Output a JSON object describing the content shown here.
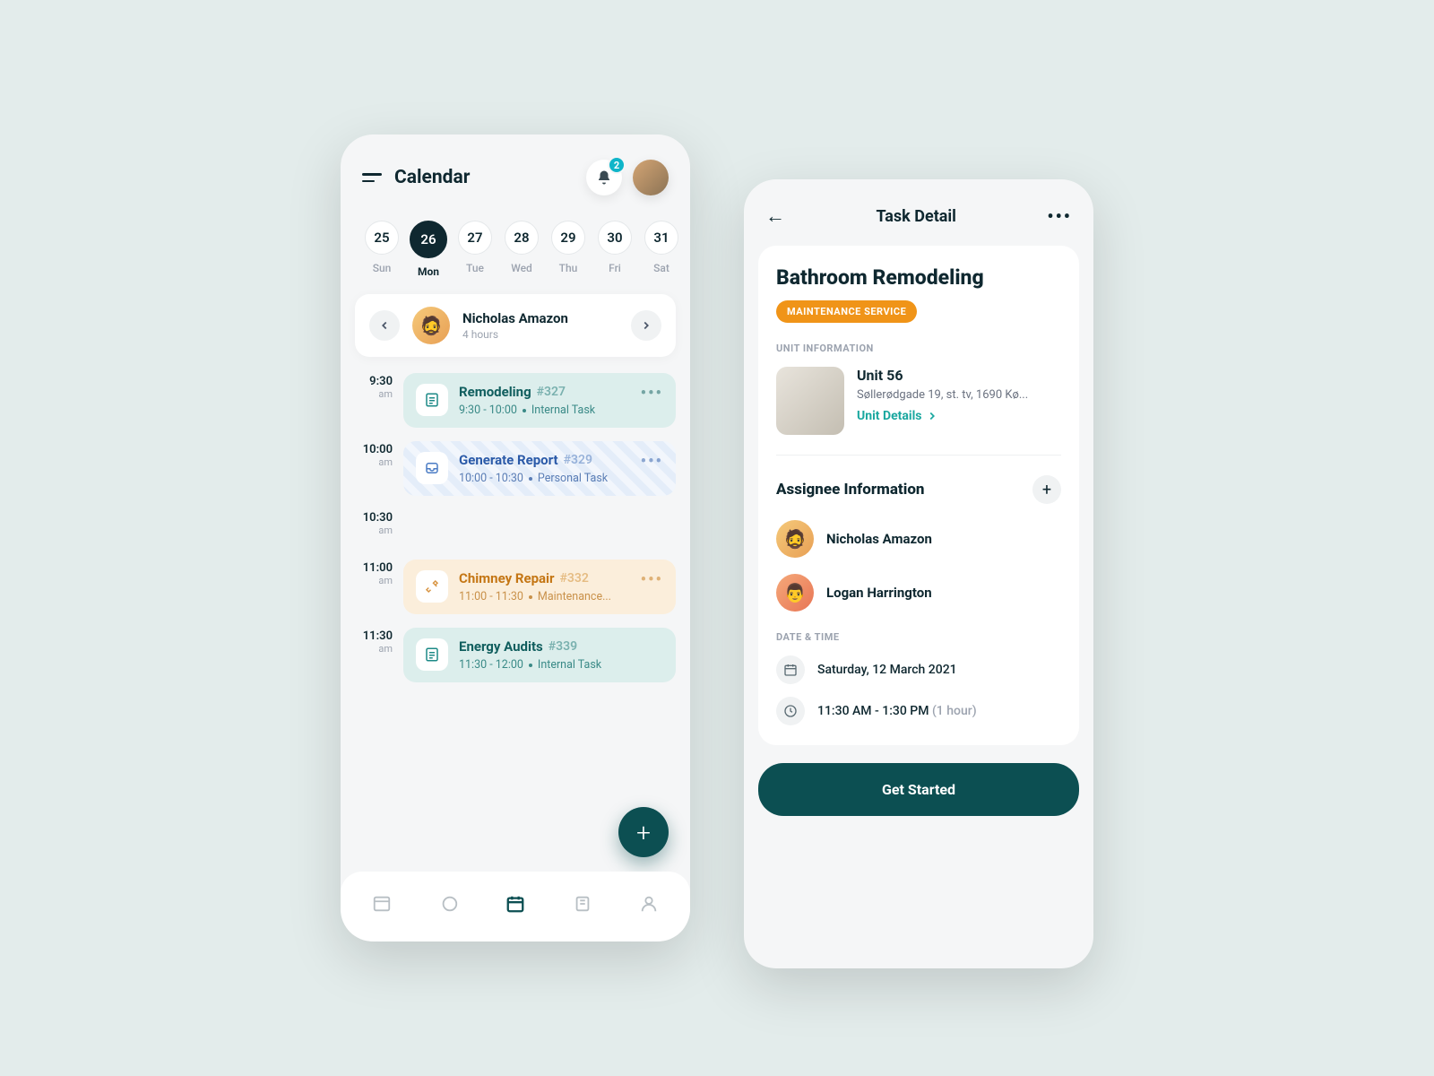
{
  "calendar": {
    "title": "Calendar",
    "notificationCount": "2",
    "dates": [
      {
        "num": "25",
        "day": "Sun"
      },
      {
        "num": "26",
        "day": "Mon"
      },
      {
        "num": "27",
        "day": "Tue"
      },
      {
        "num": "28",
        "day": "Wed"
      },
      {
        "num": "29",
        "day": "Thu"
      },
      {
        "num": "30",
        "day": "Fri"
      },
      {
        "num": "31",
        "day": "Sat"
      }
    ],
    "user": {
      "name": "Nicholas Amazon",
      "hours": "4 hours"
    },
    "times": [
      "9:30",
      "10:00",
      "10:30",
      "11:00",
      "11:30"
    ],
    "ampm": "am",
    "tasks": [
      {
        "name": "Remodeling",
        "num": "#327",
        "time": "9:30 - 10:00",
        "type": "Internal Task"
      },
      {
        "name": "Generate Report",
        "num": "#329",
        "time": "10:00 - 10:30",
        "type": "Personal Task"
      },
      {
        "name": "Chimney Repair",
        "num": "#332",
        "time": "11:00 - 11:30",
        "type": "Maintenance..."
      },
      {
        "name": "Energy Audits",
        "num": "#339",
        "time": "11:30 - 12:00",
        "type": "Internal Task"
      }
    ]
  },
  "detail": {
    "headerTitle": "Task Detail",
    "taskName": "Bathroom Remodeling",
    "badge": "MAINTENANCE SERVICE",
    "unitLabel": "UNIT INFORMATION",
    "unitName": "Unit 56",
    "unitAddr": "Søllerødgade 19, st. tv, 1690 Kø...",
    "unitLink": "Unit Details",
    "assigneeTitle": "Assignee Information",
    "assignees": [
      {
        "name": "Nicholas Amazon"
      },
      {
        "name": "Logan Harrington"
      }
    ],
    "dtLabel": "DATE & TIME",
    "date": "Saturday, 12 March 2021",
    "time": "11:30 AM - 1:30 PM",
    "duration": "(1 hour)",
    "cta": "Get Started"
  }
}
